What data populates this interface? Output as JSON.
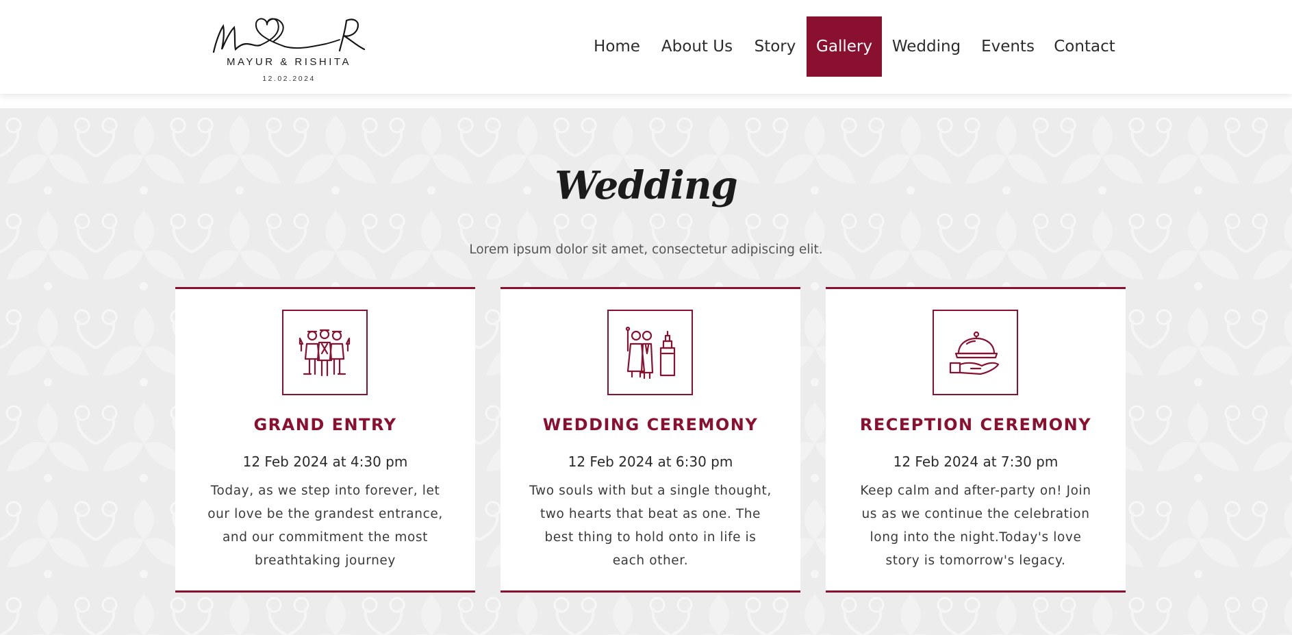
{
  "brand": {
    "names": "MAYUR & RISHITA",
    "date": "12.02.2024",
    "monogram_left": "M",
    "monogram_right": "R"
  },
  "nav": {
    "items": [
      {
        "label": "Home",
        "active": false
      },
      {
        "label": "About Us",
        "active": false
      },
      {
        "label": "Story",
        "active": false
      },
      {
        "label": "Gallery",
        "active": true
      },
      {
        "label": "Wedding",
        "active": false
      },
      {
        "label": "Events",
        "active": false
      },
      {
        "label": "Contact",
        "active": false
      }
    ]
  },
  "section": {
    "title": "Wedding",
    "subtitle": "Lorem ipsum dolor sit amet, consectetur adipiscing elit."
  },
  "cards": [
    {
      "icon": "bridal-party-icon",
      "title": "GRAND ENTRY",
      "date": "12 Feb 2024 at 4:30 pm",
      "text": "Today, as we step into forever, let our love be the grandest entrance, and our commitment the most breathtaking journey"
    },
    {
      "icon": "couple-cake-icon",
      "title": "WEDDING CEREMONY",
      "date": "12 Feb 2024 at 6:30 pm",
      "text": "Two souls with but a single thought, two hearts that beat as one. The best thing to hold onto in life is each other."
    },
    {
      "icon": "serving-cloche-icon",
      "title": "RECEPTION CEREMONY",
      "date": "12 Feb 2024 at 7:30 pm",
      "text": "Keep calm and after-party on! Join us as we continue the celebration long into the night.Today's love story is tomorrow's legacy."
    }
  ],
  "colors": {
    "accent": "#8a1030",
    "background": "#ececec",
    "card": "#ffffff",
    "text": "#2c2c2c"
  }
}
